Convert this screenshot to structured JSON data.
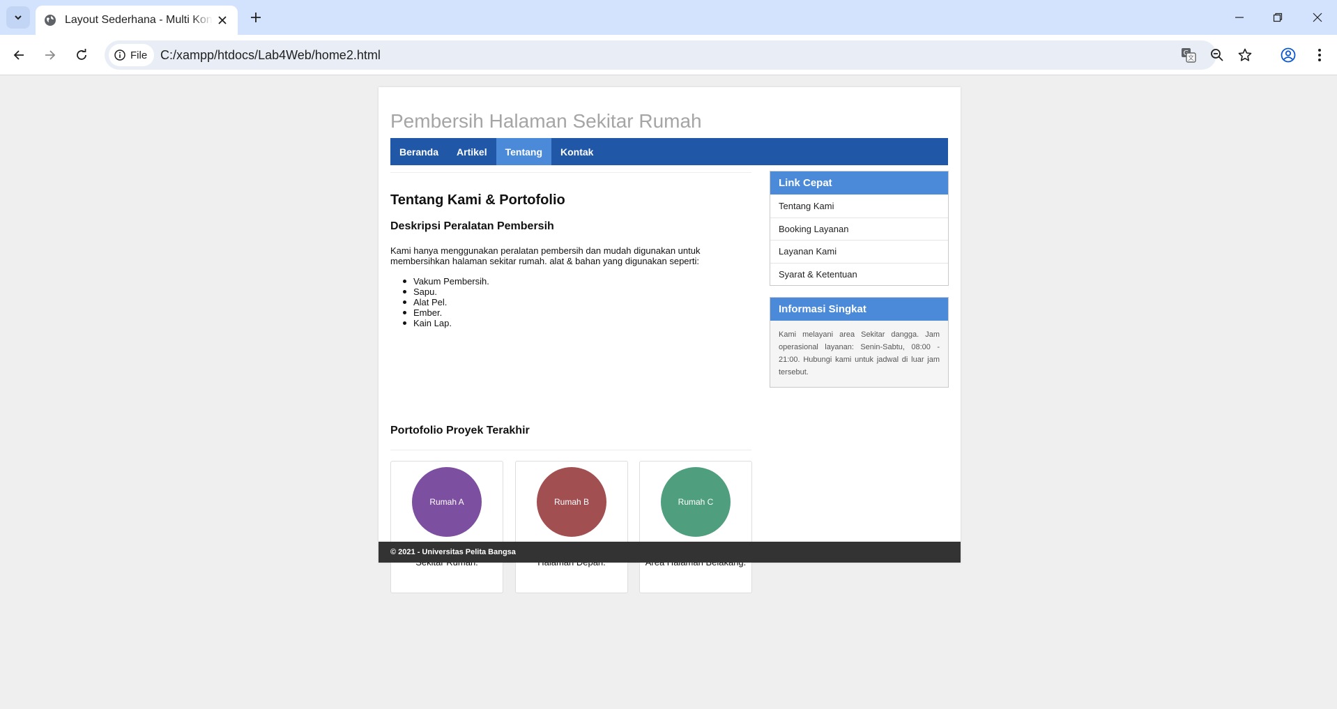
{
  "browser": {
    "tab_title": "Layout Sederhana - Multi Konten",
    "url_scheme_label": "File",
    "url": "C:/xampp/htdocs/Lab4Web/home2.html",
    "icons": [
      "tab-search-icon",
      "globe-icon",
      "close-icon",
      "plus-icon",
      "minimize-icon",
      "restore-icon",
      "window-close-icon",
      "back-arrow-icon",
      "forward-arrow-icon",
      "reload-icon",
      "info-icon",
      "translate-icon",
      "zoom-out-icon",
      "bookmark-star-icon",
      "profile-icon",
      "menu-dots-icon"
    ]
  },
  "site": {
    "title": "Pembersih Halaman Sekitar Rumah",
    "nav": [
      {
        "label": "Beranda",
        "active": false
      },
      {
        "label": "Artikel",
        "active": false
      },
      {
        "label": "Tentang",
        "active": true
      },
      {
        "label": "Kontak",
        "active": false
      }
    ],
    "accent_color": "#2157a7",
    "active_color": "#4a8ad8"
  },
  "main": {
    "heading": "Tentang Kami & Portofolio",
    "subheading": "Deskripsi Peralatan Pembersih",
    "description": "Kami hanya menggunakan peralatan pembersih dan mudah digunakan untuk membersihkan halaman sekitar rumah. alat & bahan yang digunakan seperti:",
    "tools": [
      "Vakum Pembersih.",
      "Sapu.",
      "Alat Pel.",
      "Ember.",
      "Kain Lap."
    ],
    "portfolio_heading": "Portofolio Proyek Terakhir",
    "portfolio": [
      {
        "label": "Rumah A",
        "desc": "Pembersihan Area Sekitar Rumah.",
        "color": "#7d4fa0"
      },
      {
        "label": "Rumah B",
        "desc": "Pembersihan Area Halaman Depan.",
        "color": "#a24f52"
      },
      {
        "label": "Rumah C",
        "desc": "Sanitasi dan kebersihan Area Halaman Belakang.",
        "color": "#4f9f7e"
      }
    ]
  },
  "sidebar": {
    "quick_links_title": "Link Cepat",
    "quick_links": [
      "Tentang Kami",
      "Booking Layanan",
      "Layanan Kami",
      "Syarat & Ketentuan"
    ],
    "info_title": "Informasi Singkat",
    "info_text": "Kami melayani area Sekitar dangga. Jam operasional layanan: Senin-Sabtu, 08:00 - 21:00. Hubungi kami untuk jadwal di luar jam tersebut."
  },
  "footer": {
    "text": "© 2021 - Universitas Pelita Bangsa"
  }
}
